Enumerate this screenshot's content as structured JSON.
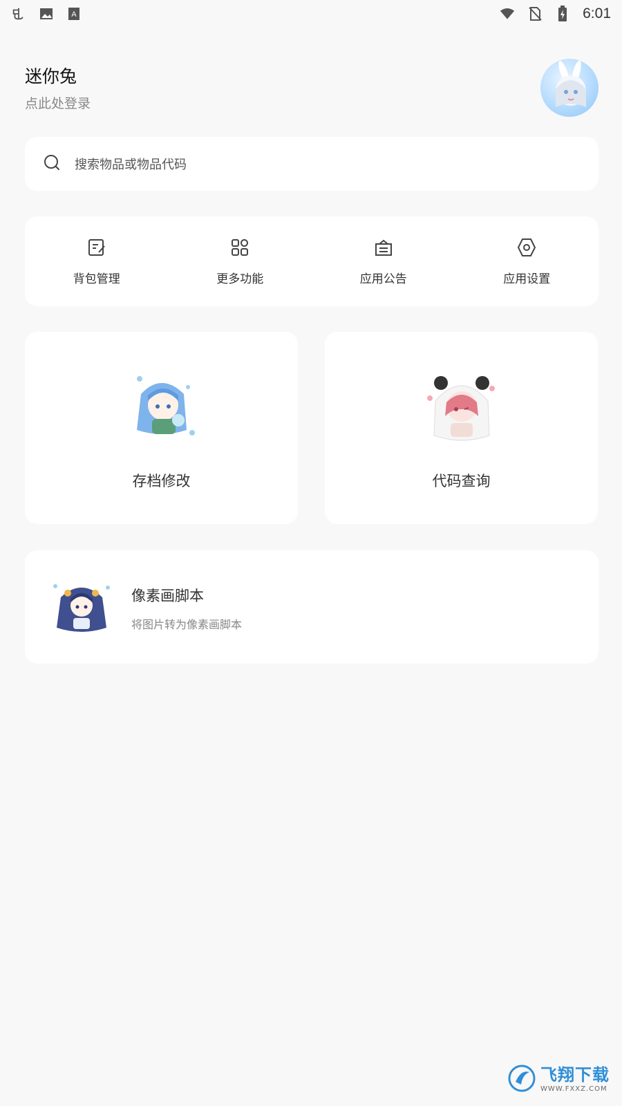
{
  "status_bar": {
    "time": "6:01",
    "left_icons": [
      "bug-notification-icon",
      "image-notification-icon",
      "font-notification-icon"
    ],
    "right_icons": [
      "wifi-icon",
      "no-sim-icon",
      "battery-charging-icon"
    ]
  },
  "profile": {
    "name": "迷你兔",
    "login_prompt": "点此处登录",
    "avatar": "anime-avatar"
  },
  "search": {
    "placeholder": "搜索物品或物品代码",
    "icon": "search-icon"
  },
  "quick_actions": [
    {
      "label": "背包管理",
      "icon": "edit-note-icon"
    },
    {
      "label": "更多功能",
      "icon": "grid-icon"
    },
    {
      "label": "应用公告",
      "icon": "announcement-icon"
    },
    {
      "label": "应用设置",
      "icon": "hex-settings-icon"
    }
  ],
  "feature_cards": [
    {
      "title": "存档修改",
      "art": "blue-hair-girl-illustration"
    },
    {
      "title": "代码查询",
      "art": "panda-hood-girl-illustration"
    }
  ],
  "script_card": {
    "title": "像素画脚本",
    "subtitle": "将图片转为像素画脚本",
    "art": "dark-blue-hair-girl-illustration"
  },
  "watermark": {
    "brand": "飞翔下载",
    "url": "WWW.FXXZ.COM"
  },
  "colors": {
    "background": "#f8f8f8",
    "card": "#ffffff",
    "watermark_blue": "#2f8fd8"
  }
}
